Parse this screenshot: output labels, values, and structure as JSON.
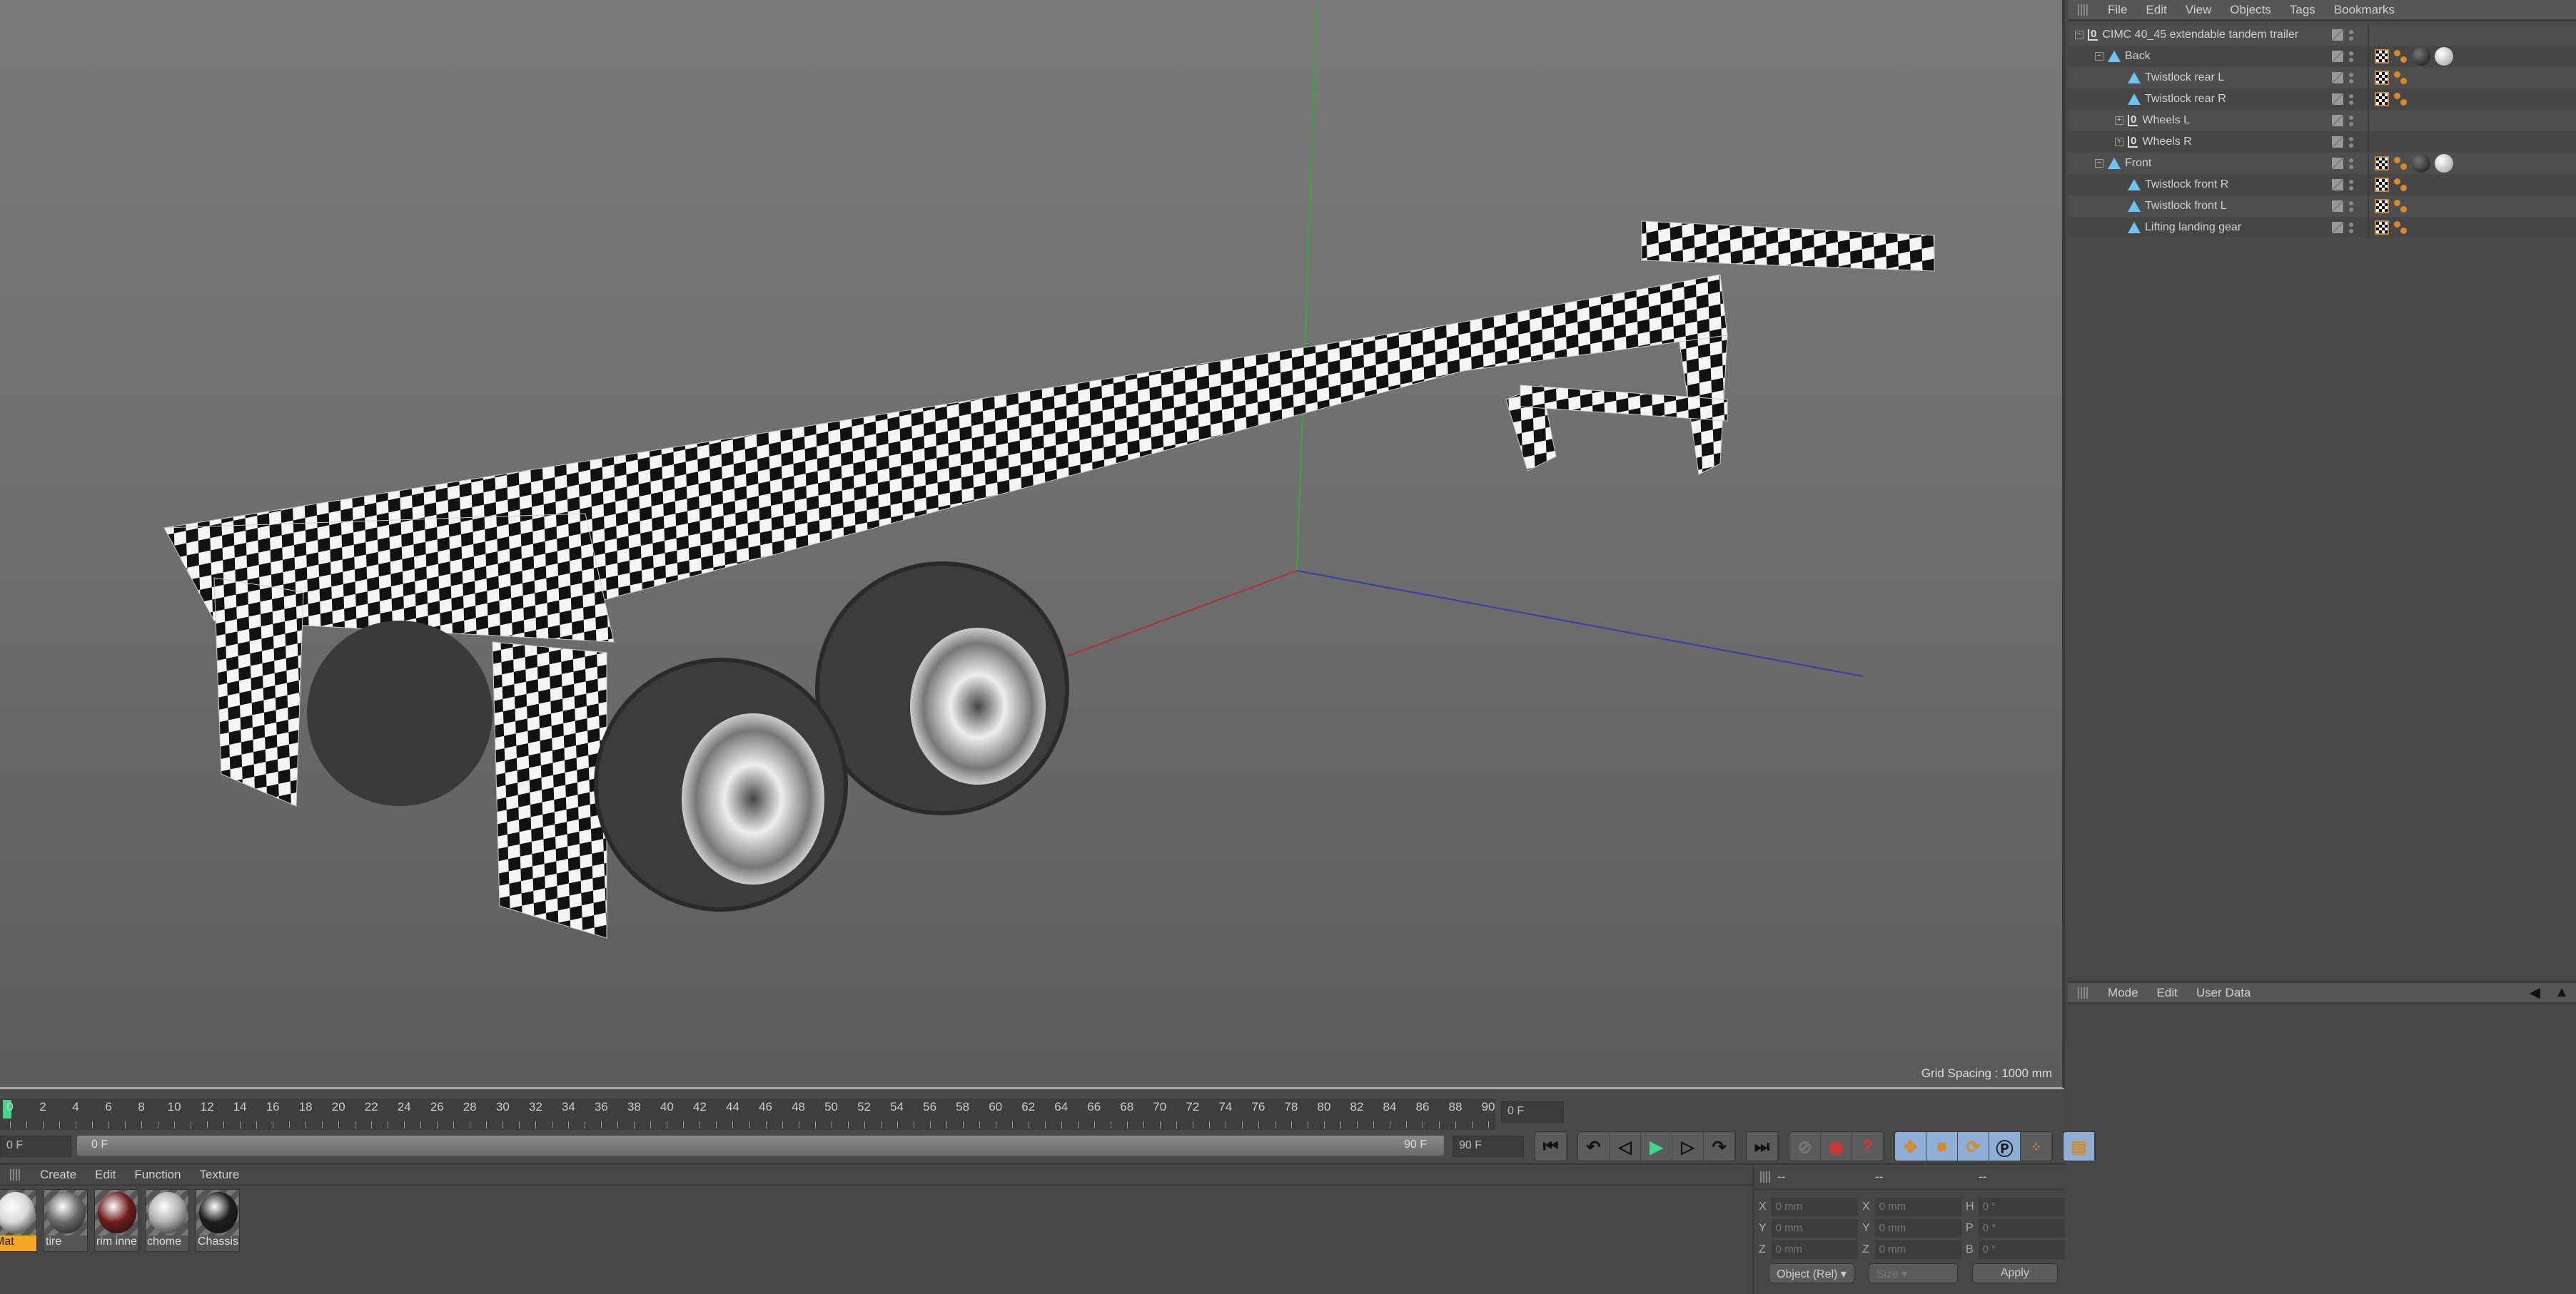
{
  "viewport": {
    "grid_spacing": "Grid Spacing : 1000 mm"
  },
  "object_manager": {
    "menu": [
      "File",
      "Edit",
      "View",
      "Objects",
      "Tags",
      "Bookmarks"
    ],
    "objects": [
      {
        "name": "CIMC 40_45 extendable tandem trailer",
        "type": "null",
        "depth": 0,
        "expand": "-",
        "tags": []
      },
      {
        "name": "Back",
        "type": "poly",
        "depth": 1,
        "expand": "-",
        "tags": [
          "checker",
          "uvw",
          "mat-black",
          "mat-white"
        ]
      },
      {
        "name": "Twistlock rear L",
        "type": "poly",
        "depth": 2,
        "expand": "",
        "tags": [
          "checker",
          "uvw"
        ]
      },
      {
        "name": "Twistlock rear R",
        "type": "poly",
        "depth": 2,
        "expand": "",
        "tags": [
          "checker",
          "uvw"
        ]
      },
      {
        "name": "Wheels L",
        "type": "null",
        "depth": 2,
        "expand": "+",
        "tags": []
      },
      {
        "name": "Wheels R",
        "type": "null",
        "depth": 2,
        "expand": "+",
        "tags": []
      },
      {
        "name": "Front",
        "type": "poly",
        "depth": 1,
        "expand": "-",
        "tags": [
          "checker",
          "uvw",
          "mat-black",
          "mat-white"
        ]
      },
      {
        "name": "Twistlock front R",
        "type": "poly",
        "depth": 2,
        "expand": "",
        "tags": [
          "checker",
          "uvw"
        ]
      },
      {
        "name": "Twistlock front L",
        "type": "poly",
        "depth": 2,
        "expand": "",
        "tags": [
          "checker",
          "uvw"
        ]
      },
      {
        "name": "Lifting landing gear",
        "type": "poly",
        "depth": 2,
        "expand": "",
        "tags": [
          "checker",
          "uvw"
        ]
      }
    ]
  },
  "attribute_manager": {
    "menu": [
      "Mode",
      "Edit",
      "User Data"
    ]
  },
  "timeline": {
    "ticks": [
      0,
      2,
      4,
      6,
      8,
      10,
      12,
      14,
      16,
      18,
      20,
      22,
      24,
      26,
      28,
      30,
      32,
      34,
      36,
      38,
      40,
      42,
      44,
      46,
      48,
      50,
      52,
      54,
      56,
      58,
      60,
      62,
      64,
      66,
      68,
      70,
      72,
      74,
      76,
      78,
      80,
      82,
      84,
      86,
      88,
      90
    ],
    "max": 90,
    "current_frame": "0 F",
    "start_field": "0 F",
    "slider_start": "0 F",
    "slider_end": "90 F",
    "end_field": "90 F"
  },
  "material_manager": {
    "menu": [
      "Create",
      "Edit",
      "Function",
      "Texture"
    ],
    "materials": [
      {
        "name": "Mat",
        "color": "#d8d8d8",
        "selected": true
      },
      {
        "name": "tire",
        "color": "#6a6a6a"
      },
      {
        "name": "rim inne",
        "color": "#6e1c1c"
      },
      {
        "name": "chome",
        "color": "#b0b0b0"
      },
      {
        "name": "Chassis",
        "color": "#1e1e1e"
      }
    ]
  },
  "coordinates": {
    "headers": [
      "--",
      "--",
      "--"
    ],
    "rows": [
      {
        "l1": "X",
        "v1": "0 mm",
        "l2": "X",
        "v2": "0 mm",
        "l3": "H",
        "v3": "0 °"
      },
      {
        "l1": "Y",
        "v1": "0 mm",
        "l2": "Y",
        "v2": "0 mm",
        "l3": "P",
        "v3": "0 °"
      },
      {
        "l1": "Z",
        "v1": "0 mm",
        "l2": "Z",
        "v2": "0 mm",
        "l3": "B",
        "v3": "0 °"
      }
    ],
    "mode": "Object (Rel)",
    "size": "Size",
    "apply": "Apply"
  }
}
